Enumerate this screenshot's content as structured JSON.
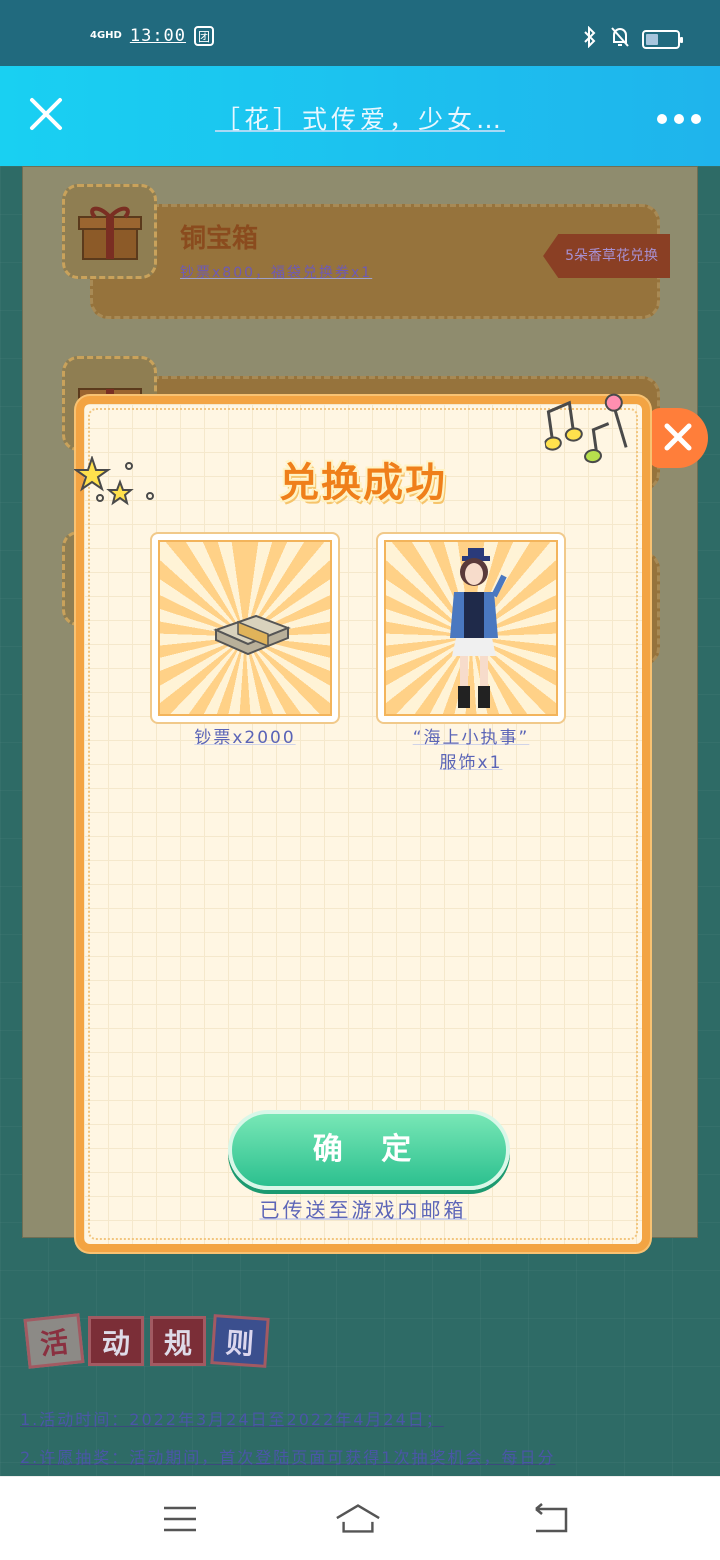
{
  "status_bar": {
    "network": "4GHD",
    "time": "13:00",
    "app_badge": "团",
    "battery_level": 0.4
  },
  "header": {
    "title": "［花］式传爱，少女…"
  },
  "background": {
    "cards": [
      {
        "name": "铜宝箱",
        "desc": "钞票x800，福袋兑换券x1",
        "redeem": "5朵香草花兑换"
      }
    ],
    "rules": {
      "title_chars": [
        "活",
        "动",
        "规",
        "则"
      ],
      "lines": [
        "1.活动时间：2022年3月24日至2022年4月24日；",
        "2.许愿抽奖：活动期间，首次登陆页面可获得1次抽奖机会，每日分"
      ]
    }
  },
  "modal": {
    "title": "兑换成功",
    "items": [
      {
        "label": "钞票x2000"
      },
      {
        "label_line1": "“海上小执事”",
        "label_line2": "服饰x1"
      }
    ],
    "confirm_label": "确 定",
    "note": "已传送至游戏内邮箱"
  }
}
